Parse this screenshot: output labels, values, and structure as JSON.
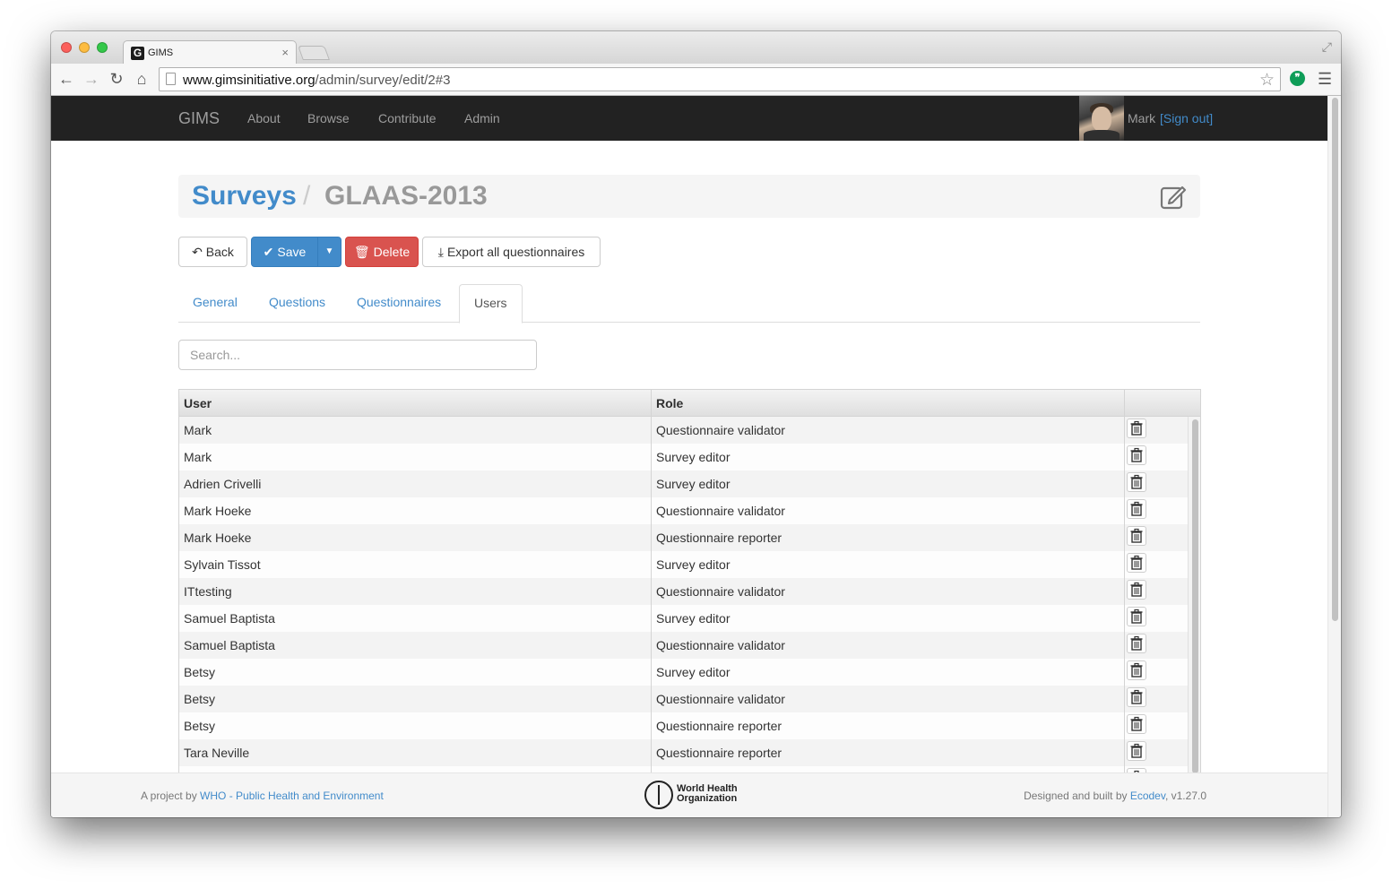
{
  "browser": {
    "tab_title": "GIMS",
    "tab_close": "×",
    "favicon_letter": "G",
    "url_host": "www.gimsinitiative.org",
    "url_path": "/admin/survey/edit/2#3"
  },
  "navbar": {
    "brand": "GIMS",
    "links": [
      "About",
      "Browse",
      "Contribute",
      "Admin"
    ],
    "user_name": "Mark",
    "sign_out": "[Sign out]"
  },
  "header": {
    "crumb_link": "Surveys",
    "crumb_separator": "/",
    "crumb_current": "GLAAS-2013"
  },
  "actions": {
    "back": "Back",
    "save": "Save",
    "delete": "Delete",
    "export": "Export all questionnaires"
  },
  "tabs": [
    "General",
    "Questions",
    "Questionnaires",
    "Users"
  ],
  "active_tab": "Users",
  "search": {
    "placeholder": "Search..."
  },
  "grid": {
    "columns": [
      "User",
      "Role"
    ],
    "rows": [
      {
        "user": "Mark",
        "role": "Questionnaire validator"
      },
      {
        "user": "Mark",
        "role": "Survey editor"
      },
      {
        "user": "Adrien Crivelli",
        "role": "Survey editor"
      },
      {
        "user": "Mark Hoeke",
        "role": "Questionnaire validator"
      },
      {
        "user": "Mark Hoeke",
        "role": "Questionnaire reporter"
      },
      {
        "user": "Sylvain Tissot",
        "role": "Survey editor"
      },
      {
        "user": "ITtesting",
        "role": "Questionnaire validator"
      },
      {
        "user": "Samuel Baptista",
        "role": "Survey editor"
      },
      {
        "user": "Samuel Baptista",
        "role": "Questionnaire validator"
      },
      {
        "user": "Betsy",
        "role": "Survey editor"
      },
      {
        "user": "Betsy",
        "role": "Questionnaire validator"
      },
      {
        "user": "Betsy",
        "role": "Questionnaire reporter"
      },
      {
        "user": "Tara Neville",
        "role": "Questionnaire reporter"
      },
      {
        "user": "",
        "role": ""
      }
    ]
  },
  "footer": {
    "left_prefix": "A project by ",
    "left_link": "WHO - Public Health and Environment",
    "logo_line1": "World Health",
    "logo_line2": "Organization",
    "right_prefix": "Designed and built by ",
    "right_link": "Ecodev",
    "right_suffix": ", v1.27.0"
  },
  "colors": {
    "primary": "#428bca",
    "danger": "#d9534f",
    "navbar": "#222222"
  }
}
